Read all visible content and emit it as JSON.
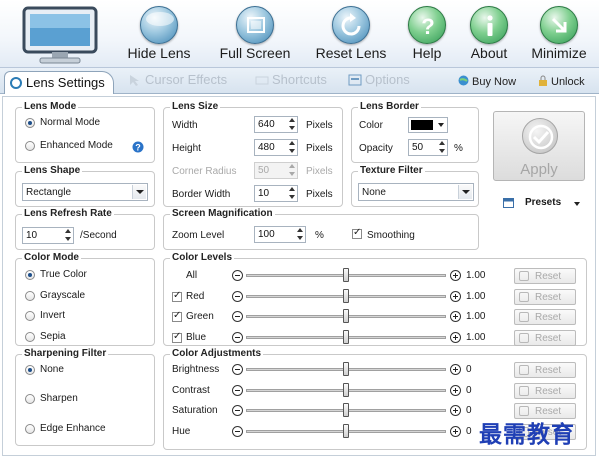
{
  "toolbar": {
    "buttons": [
      {
        "label": "Hide Lens",
        "icon": "hide-lens-icon"
      },
      {
        "label": "Full Screen",
        "icon": "full-screen-icon"
      },
      {
        "label": "Reset Lens",
        "icon": "reset-lens-icon"
      },
      {
        "label": "Help",
        "icon": "help-icon"
      },
      {
        "label": "About",
        "icon": "about-icon"
      },
      {
        "label": "Minimize",
        "icon": "minimize-icon"
      }
    ]
  },
  "tabs": {
    "items": [
      {
        "label": "Lens Settings",
        "active": true
      },
      {
        "label": "Cursor Effects",
        "active": false
      },
      {
        "label": "Shortcuts",
        "active": false
      },
      {
        "label": "Options",
        "active": false
      }
    ],
    "buy_now": "Buy Now",
    "unlock": "Unlock"
  },
  "lens_mode": {
    "title": "Lens Mode",
    "options": [
      "Normal Mode",
      "Enhanced Mode"
    ],
    "selected": "Normal Mode"
  },
  "lens_shape": {
    "title": "Lens Shape",
    "value": "Rectangle"
  },
  "lens_refresh": {
    "title": "Lens Refresh Rate",
    "value": "10",
    "unit": "/Second"
  },
  "lens_size": {
    "title": "Lens Size",
    "width_label": "Width",
    "width_value": "640",
    "height_label": "Height",
    "height_value": "480",
    "corner_label": "Corner Radius",
    "corner_value": "50",
    "border_label": "Border Width",
    "border_value": "10",
    "unit": "Pixels"
  },
  "lens_border": {
    "title": "Lens Border",
    "color_label": "Color",
    "color_value": "#000000",
    "opacity_label": "Opacity",
    "opacity_value": "50",
    "opacity_unit": "%"
  },
  "texture_filter": {
    "title": "Texture Filter",
    "value": "None"
  },
  "apply": {
    "label": "Apply"
  },
  "presets": {
    "label": "Presets"
  },
  "screen_magnification": {
    "title": "Screen Magnification",
    "zoom_label": "Zoom Level",
    "zoom_value": "100",
    "zoom_unit": "%",
    "smoothing_label": "Smoothing",
    "smoothing_checked": true
  },
  "color_mode": {
    "title": "Color Mode",
    "options": [
      "True Color",
      "Grayscale",
      "Invert",
      "Sepia"
    ],
    "selected": "True Color"
  },
  "color_levels": {
    "title": "Color Levels",
    "rows": [
      {
        "label": "All",
        "value": "1.00",
        "checkbox": false,
        "checked": false,
        "level": 0.5
      },
      {
        "label": "Red",
        "value": "1.00",
        "checkbox": true,
        "checked": true,
        "level": 0.5
      },
      {
        "label": "Green",
        "value": "1.00",
        "checkbox": true,
        "checked": true,
        "level": 0.5
      },
      {
        "label": "Blue",
        "value": "1.00",
        "checkbox": true,
        "checked": true,
        "level": 0.5
      }
    ],
    "reset_label": "Reset"
  },
  "sharpening": {
    "title": "Sharpening Filter",
    "options": [
      "None",
      "Sharpen",
      "Edge Enhance"
    ],
    "selected": "None"
  },
  "color_adjustments": {
    "title": "Color Adjustments",
    "rows": [
      {
        "label": "Brightness",
        "value": "0",
        "level": 0.5
      },
      {
        "label": "Contrast",
        "value": "0",
        "level": 0.5
      },
      {
        "label": "Saturation",
        "value": "0",
        "level": 0.5
      },
      {
        "label": "Hue",
        "value": "0",
        "level": 0.5
      }
    ],
    "reset_label": "Reset"
  },
  "watermark": "最需教育"
}
